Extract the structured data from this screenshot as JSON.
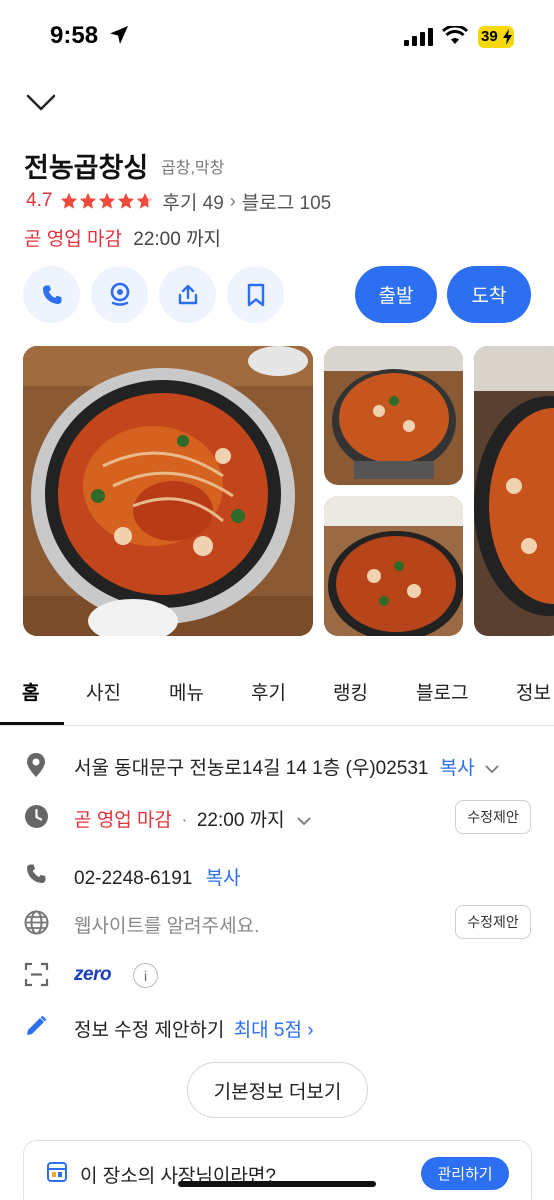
{
  "status_bar": {
    "time": "9:58",
    "battery": "39"
  },
  "place": {
    "name": "전농곱창싱",
    "category": "곱창,막창",
    "rating": "4.7",
    "rating_stars": 4.7,
    "reviews_label": "후기 49",
    "blog_label": "블로그 105",
    "hours_status": "곧 영업 마감",
    "hours_close": "22:00 까지"
  },
  "actions": {
    "departure_label": "출발",
    "arrival_label": "도착"
  },
  "tabs": [
    {
      "label": "홈",
      "active": true
    },
    {
      "label": "사진"
    },
    {
      "label": "메뉴"
    },
    {
      "label": "후기"
    },
    {
      "label": "랭킹"
    },
    {
      "label": "블로그"
    },
    {
      "label": "정보"
    }
  ],
  "info": {
    "address": "서울 동대문구 전농로14길 14 1층 (우)02531",
    "copy_label": "복사",
    "hours_status": "곧 영업 마감",
    "hours_dot": "·",
    "hours_close": "22:00 까지",
    "suggest_label": "수정제안",
    "phone": "02-2248-6191",
    "website_placeholder": "웹사이트를 알려주세요.",
    "zero_pay": "zero",
    "info_mark": "i",
    "edit_suggest": "정보 수정 제안하기",
    "edit_reward": "최대 5점"
  },
  "more_button": "기본정보 더보기",
  "owner": {
    "text": "이 장소의 사장님이라면?",
    "manage_label": "관리하기"
  },
  "colors": {
    "accent": "#2c6ff0",
    "alert": "#e2323c",
    "star": "#ef4a3c"
  }
}
